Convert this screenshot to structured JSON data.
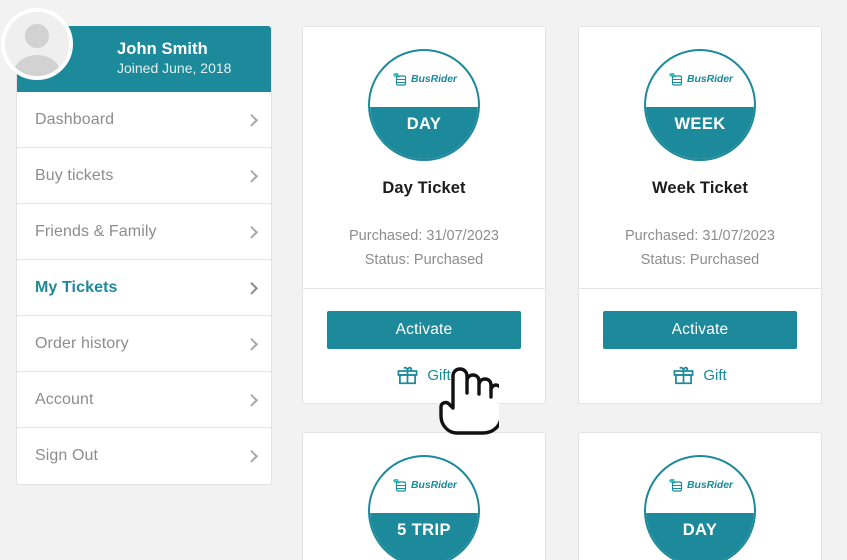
{
  "brand": {
    "name": "BusRider",
    "accent": "#1d8a9b",
    "muted": "#8d8d8d",
    "page_bg": "#f2f2f2"
  },
  "sidebar": {
    "user": {
      "name": "John Smith",
      "joined": "Joined June, 2018",
      "avatar_icon": "user-placeholder-icon"
    },
    "items": [
      {
        "label": "Dashboard",
        "active": false,
        "chevron_icon": "chevron-right-icon"
      },
      {
        "label": "Buy tickets",
        "active": false,
        "chevron_icon": "chevron-right-icon"
      },
      {
        "label": "Friends & Family",
        "active": false,
        "chevron_icon": "chevron-right-icon"
      },
      {
        "label": "My Tickets",
        "active": true,
        "chevron_icon": "chevron-right-icon"
      },
      {
        "label": "Order history",
        "active": false,
        "chevron_icon": "chevron-right-icon"
      },
      {
        "label": "Account",
        "active": false,
        "chevron_icon": "chevron-right-icon"
      },
      {
        "label": "Sign Out",
        "active": false,
        "chevron_icon": "chevron-right-icon"
      }
    ]
  },
  "tickets": [
    {
      "badge_type": "DAY",
      "title": "Day Ticket",
      "purchased": "Purchased: 31/07/2023",
      "status": "Status: Purchased",
      "activate_label": "Activate",
      "gift_label": "Gift",
      "gift_icon": "gift-icon",
      "logo_icon": "busrider-logo-icon",
      "partial": false
    },
    {
      "badge_type": "WEEK",
      "title": "Week Ticket",
      "purchased": "Purchased: 31/07/2023",
      "status": "Status: Purchased",
      "activate_label": "Activate",
      "gift_label": "Gift",
      "gift_icon": "gift-icon",
      "logo_icon": "busrider-logo-icon",
      "partial": false
    },
    {
      "badge_type": "5 TRIP",
      "title": "",
      "purchased": "",
      "status": "",
      "activate_label": "",
      "gift_label": "",
      "gift_icon": "gift-icon",
      "logo_icon": "busrider-logo-icon",
      "partial": true
    },
    {
      "badge_type": "DAY",
      "title": "",
      "purchased": "",
      "status": "",
      "activate_label": "",
      "gift_label": "",
      "gift_icon": "gift-icon",
      "logo_icon": "busrider-logo-icon",
      "partial": true
    }
  ],
  "cursor": {
    "icon": "pointing-hand-cursor"
  }
}
